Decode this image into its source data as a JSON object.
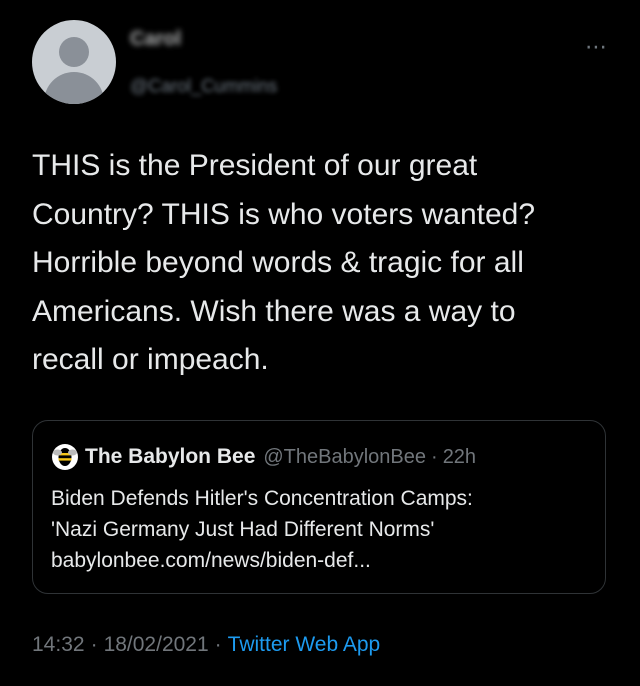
{
  "author": {
    "name": "Carol",
    "handle": "@Carol_Cummins"
  },
  "menu": {
    "more_icon": "⋯"
  },
  "tweet": {
    "lines": [
      "THIS is the President of our great",
      "Country?  THIS is who voters wanted?",
      "Horrible beyond words & tragic for all",
      "Americans. Wish there was a way to",
      "recall or impeach."
    ]
  },
  "quote": {
    "logo_icon": "babylon-bee-logo",
    "name": "The Babylon Bee",
    "handle": "@TheBabylonBee",
    "dot": "·",
    "time": "22h",
    "title_lines": [
      "Biden Defends Hitler's Concentration Camps:",
      "'Nazi Germany Just Had Different Norms'"
    ],
    "link": "babylonbee.com/news/biden-def..."
  },
  "meta": {
    "time": "14:32",
    "sep1": "·",
    "date": "18/02/2021",
    "sep2": "·",
    "app": "Twitter Web App"
  },
  "colors": {
    "background": "#000000",
    "text": "#e7e9ea",
    "secondary": "#71767b",
    "link": "#1d9bf0",
    "border": "#2f3336"
  }
}
